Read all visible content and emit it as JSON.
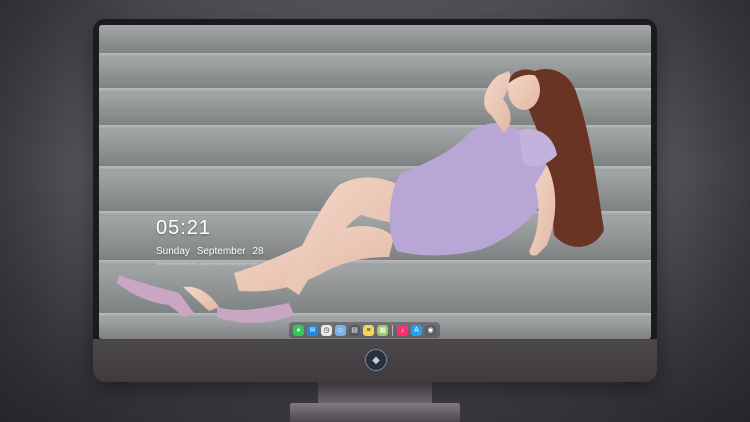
{
  "lock_screen": {
    "time": "05:21",
    "weekday": "Sunday",
    "month": "September",
    "day": "28",
    "faint_text": "Some text unseen here, please provide something to see"
  },
  "dock": {
    "icons": [
      {
        "name": "messages-icon",
        "color": "#34c759",
        "glyph": "●"
      },
      {
        "name": "mail-icon",
        "color": "#1e88e5",
        "glyph": "✉"
      },
      {
        "name": "clock-icon",
        "color": "#e8e8e8",
        "glyph": "◷"
      },
      {
        "name": "finder-icon",
        "color": "#7fb2e5",
        "glyph": "☺"
      },
      {
        "name": "clapper-icon",
        "color": "#555a60",
        "glyph": "▤"
      },
      {
        "name": "notes-icon",
        "color": "#f4d35e",
        "glyph": "≡"
      },
      {
        "name": "photos-icon",
        "color": "#9ccc65",
        "glyph": "▦"
      },
      {
        "name": "music-icon",
        "color": "#ff2d78",
        "glyph": "♪"
      },
      {
        "name": "app-store-icon",
        "color": "#2a9df4",
        "glyph": "A"
      },
      {
        "name": "camera-icon",
        "color": "#5b5f66",
        "glyph": "◉"
      }
    ]
  },
  "colors": {
    "dress": "#b8a7d6",
    "hair": "#6a3424",
    "stone": "#8f9393"
  }
}
